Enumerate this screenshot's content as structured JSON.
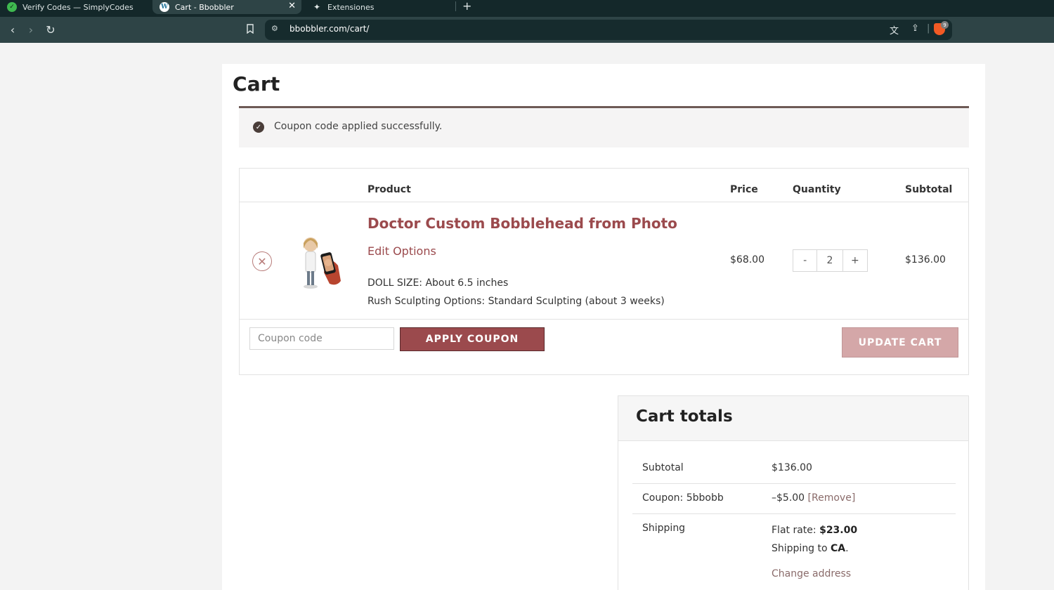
{
  "browser": {
    "tabs": [
      {
        "title": "Verify Codes — SimplyCodes",
        "icon": "simplycodes-icon"
      },
      {
        "title": "Cart - Bbobbler",
        "icon": "wordpress-icon",
        "active": true
      },
      {
        "title": "Extensiones",
        "icon": "puzzle-icon"
      }
    ],
    "url": "bbobbler.com/cart/",
    "shields_badge": "9"
  },
  "page": {
    "title": "Cart",
    "notice": "Coupon code applied successfully."
  },
  "cart": {
    "headers": {
      "product": "Product",
      "price": "Price",
      "quantity": "Quantity",
      "subtotal": "Subtotal"
    },
    "item": {
      "name": "Doctor Custom Bobblehead from Photo",
      "edit_options": "Edit Options",
      "meta": [
        "DOLL SIZE: About 6.5 inches",
        "Rush Sculpting Options: Standard Sculpting (about 3 weeks)"
      ],
      "price": "$68.00",
      "qty_minus": "-",
      "quantity": "2",
      "qty_plus": "+",
      "subtotal": "$136.00"
    },
    "coupon_placeholder": "Coupon code",
    "apply_label": "APPLY COUPON",
    "update_label": "UPDATE CART"
  },
  "totals": {
    "title": "Cart totals",
    "subtotal_label": "Subtotal",
    "subtotal_value": "$136.00",
    "coupon_label": "Coupon: 5bbobb",
    "coupon_value": "–$5.00",
    "coupon_remove": "[Remove]",
    "shipping_label": "Shipping",
    "flat_rate_label": "Flat rate: ",
    "flat_rate_value": "$23.00",
    "shipping_to_label": "Shipping to ",
    "shipping_to_value": "CA",
    "change_address": "Change address"
  },
  "colors": {
    "accent": "#9b4a4d",
    "update_button": "#d4a7a8",
    "chrome_dark": "#14282a",
    "chrome_toolbar": "#2e4446"
  }
}
